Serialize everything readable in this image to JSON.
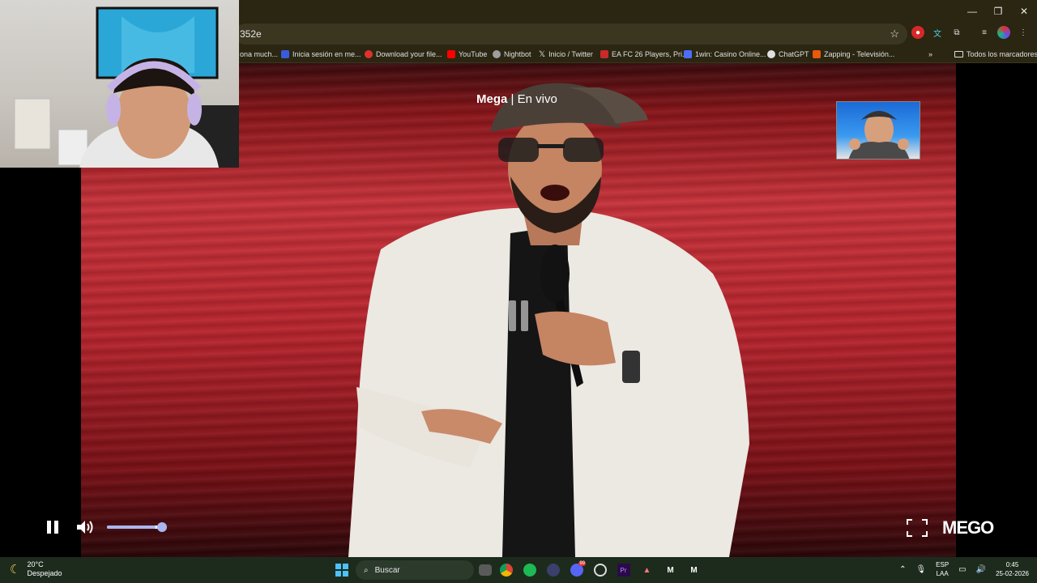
{
  "browser": {
    "url_fragment": "352e",
    "window_controls": {
      "minimize": "—",
      "restore": "❐",
      "close": "✕"
    },
    "bookmarks": [
      {
        "label": "ona much...",
        "icon": "bookmark-icon",
        "color": "#7a7a7a"
      },
      {
        "label": "Inicia sesión en me...",
        "icon": "bookmark-icon",
        "color": "#3b5bdb"
      },
      {
        "label": "Download your file...",
        "icon": "bookmark-icon",
        "color": "#e03131"
      },
      {
        "label": "YouTube",
        "icon": "youtube-icon",
        "color": "#ff0000"
      },
      {
        "label": "Nightbot",
        "icon": "nightbot-icon",
        "color": "#9e9e9e"
      },
      {
        "label": "Inicio / Twitter",
        "icon": "x-icon",
        "color": "#ffffff"
      },
      {
        "label": "EA FC 26 Players, Pri...",
        "icon": "bookmark-icon",
        "color": "#c92a2a"
      },
      {
        "label": "1win: Casino Online...",
        "icon": "bookmark-icon",
        "color": "#4c6ef5"
      },
      {
        "label": "ChatGPT",
        "icon": "chatgpt-icon",
        "color": "#e0e0e0"
      },
      {
        "label": "Zapping - Televisión...",
        "icon": "bookmark-icon",
        "color": "#e8590c"
      }
    ],
    "bookmarks_more": "»",
    "all_bookmarks": "Todos los marcadores"
  },
  "player": {
    "channel": "Mega",
    "separator": "|",
    "status": "En vivo",
    "volume": 0.88,
    "brand": "MEGO",
    "colors": {
      "slider": "#aab6f0",
      "video_bg": "#c8323a"
    }
  },
  "taskbar": {
    "weather_temp": "20°C",
    "weather_desc": "Despejado",
    "search_placeholder": "Buscar",
    "lang_top": "ESP",
    "lang_bottom": "LAA",
    "time": "0:45",
    "date": "25-02-2026",
    "discord_badge": "99"
  }
}
